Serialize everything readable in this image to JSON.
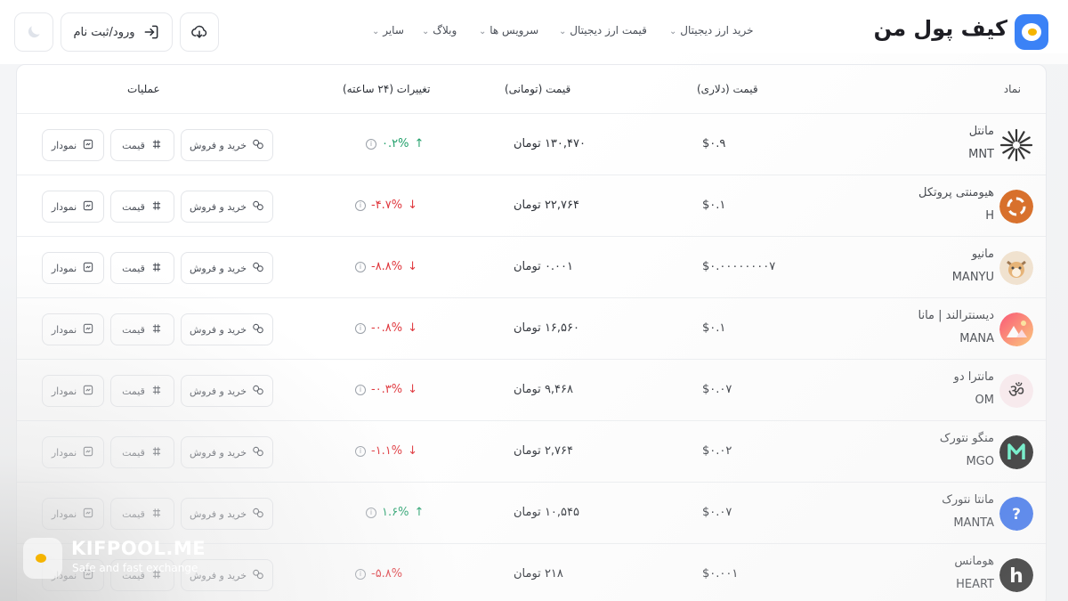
{
  "header": {
    "logo_text": "کیف پول من",
    "nav": [
      {
        "label": "خرید ارز دیجیتال"
      },
      {
        "label": "قیمت ارز دیجیتال"
      },
      {
        "label": "سرویس ها"
      },
      {
        "label": "وبلاگ"
      },
      {
        "label": "سایر"
      }
    ],
    "login_label": "ورود/ثبت نام",
    "icons": {
      "download": "cloud-download-icon",
      "login": "login-icon",
      "theme": "moon-icon",
      "chevron": "chevron-down-icon"
    }
  },
  "table": {
    "headers": {
      "symbol": "نماد",
      "usd": "قیمت (دلاری)",
      "toman": "قیمت (تومانی)",
      "change": "تغییرات (۲۴ ساعته)",
      "ops": "عملیات"
    },
    "actions": {
      "buy_sell": "خرید و فروش",
      "price": "قیمت",
      "chart": "نمودار"
    },
    "rows": [
      {
        "name": "مانتل",
        "symbol": "MNT",
        "usd": "$۰.۹",
        "toman": "۱۳۰,۴۷۰ تومان",
        "change": "۰.۲%",
        "arrow": "↑",
        "direction": "up",
        "icon": "mantle-icon",
        "icon_color": "#111111"
      },
      {
        "name": "هیومنتی پروتکل",
        "symbol": "H",
        "usd": "$۰.۱",
        "toman": "۲۲,۷۶۴ تومان",
        "change": "-۴.۷%",
        "arrow": "↓",
        "direction": "down",
        "icon": "humanity-icon",
        "icon_color": "#d35400"
      },
      {
        "name": "مانیو",
        "symbol": "MANYU",
        "usd": "$۰.۰۰۰۰۰۰۰۰۷",
        "toman": "۰.۰۰۱ تومان",
        "change": "-۸.۸%",
        "arrow": "↓",
        "direction": "down",
        "icon": "shiba-dog-icon",
        "icon_color": "#f2e0c8"
      },
      {
        "name": "دیسنترالند | مانا",
        "symbol": "MANA",
        "usd": "$۰.۱",
        "toman": "۱۶,۵۶۰ تومان",
        "change": "-۰.۸%",
        "arrow": "↓",
        "direction": "down",
        "icon": "decentraland-icon",
        "icon_color": "#ff4f6e"
      },
      {
        "name": "مانترا دو",
        "symbol": "OM",
        "usd": "$۰.۰۷",
        "toman": "۹,۴۶۸ تومان",
        "change": "-۰.۳%",
        "arrow": "↓",
        "direction": "down",
        "icon": "om-icon",
        "icon_color": "#fbe9ee"
      },
      {
        "name": "منگو نتورک",
        "symbol": "MGO",
        "usd": "$۰.۰۲",
        "toman": "۲,۷۶۴ تومان",
        "change": "-۱.۱%",
        "arrow": "↓",
        "direction": "down",
        "icon": "mango-icon",
        "icon_color": "#0b0b0b"
      },
      {
        "name": "مانتا نتورک",
        "symbol": "MANTA",
        "usd": "$۰.۰۷",
        "toman": "۱۰,۵۴۵ تومان",
        "change": "۱.۶%",
        "arrow": "↑",
        "direction": "up",
        "icon": "question-icon",
        "icon_color": "#2563eb"
      },
      {
        "name": "هومانس",
        "symbol": "HEART",
        "usd": "$۰.۰۰۱",
        "toman": "۲۱۸ تومان",
        "change": "-۵.۸%",
        "arrow": "",
        "direction": "down",
        "icon": "humans-h-icon",
        "icon_color": "#0a0a0a"
      }
    ]
  },
  "watermark": {
    "title": "KIFPOOL.ME",
    "subtitle": "Safe and fast exchange"
  },
  "colors": {
    "accent": "#3b82f6",
    "up": "#22a06b",
    "down": "#e0383e",
    "brand_yellow": "#f5b400"
  }
}
